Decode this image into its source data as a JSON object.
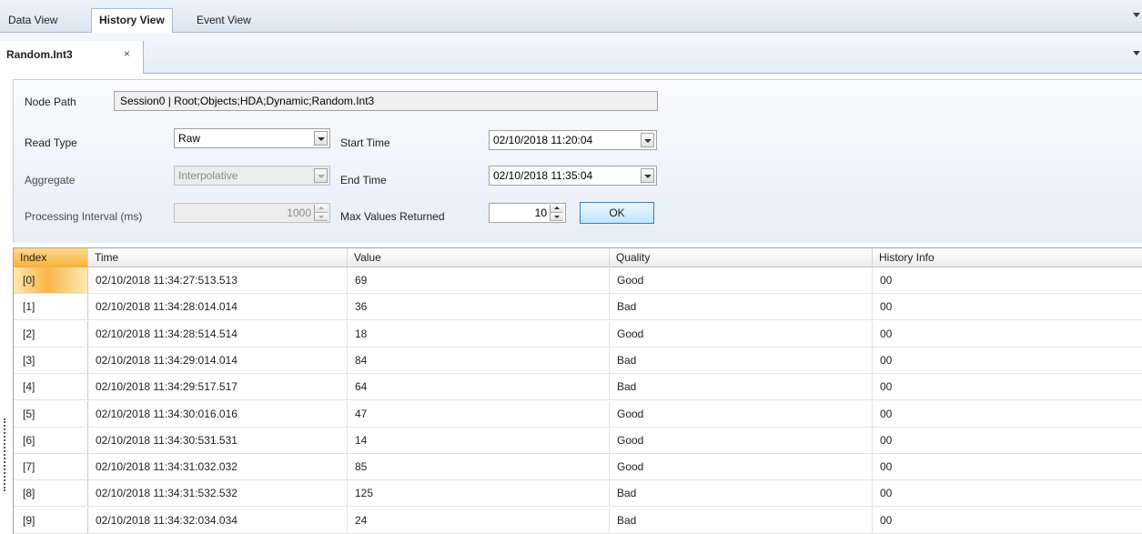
{
  "view_tabs": [
    {
      "label": "Data View",
      "active": false
    },
    {
      "label": "History View",
      "active": true
    },
    {
      "label": "Event View",
      "active": false
    }
  ],
  "document_tab": {
    "label": "Random.Int3",
    "close_glyph": "×"
  },
  "form": {
    "node_path_label": "Node Path",
    "node_path_value": "Session0 | Root;Objects;HDA;Dynamic;Random.Int3",
    "read_type_label": "Read Type",
    "read_type_value": "Raw",
    "aggregate_label": "Aggregate",
    "aggregate_value": "Interpolative",
    "processing_interval_label": "Processing Interval (ms)",
    "processing_interval_value": "1000",
    "start_time_label": "Start Time",
    "start_time_value": "02/10/2018 11:20:04",
    "end_time_label": "End Time",
    "end_time_value": "02/10/2018 11:35:04",
    "max_values_label": "Max Values Returned",
    "max_values_value": "10",
    "ok_label": "OK"
  },
  "grid": {
    "columns": [
      "Index",
      "Time",
      "Value",
      "Quality",
      "History Info"
    ],
    "rows": [
      [
        "[0]",
        "02/10/2018 11:34:27:513.513",
        "69",
        "Good",
        "00"
      ],
      [
        "[1]",
        "02/10/2018 11:34:28:014.014",
        "36",
        "Bad",
        "00"
      ],
      [
        "[2]",
        "02/10/2018 11:34:28:514.514",
        "18",
        "Good",
        "00"
      ],
      [
        "[3]",
        "02/10/2018 11:34:29:014.014",
        "84",
        "Bad",
        "00"
      ],
      [
        "[4]",
        "02/10/2018 11:34:29:517.517",
        "64",
        "Bad",
        "00"
      ],
      [
        "[5]",
        "02/10/2018 11:34:30:016.016",
        "47",
        "Good",
        "00"
      ],
      [
        "[6]",
        "02/10/2018 11:34:30:531.531",
        "14",
        "Good",
        "00"
      ],
      [
        "[7]",
        "02/10/2018 11:34:31:032.032",
        "85",
        "Good",
        "00"
      ],
      [
        "[8]",
        "02/10/2018 11:34:31:532.532",
        "125",
        "Bad",
        "00"
      ],
      [
        "[9]",
        "02/10/2018 11:34:32:034.034",
        "24",
        "Bad",
        "00"
      ]
    ]
  },
  "colors": {
    "selection_accent": "#f6b13d",
    "ok_button_border": "#3c7fb1",
    "tab_border": "#a9b9cf"
  },
  "icons": [
    "tab-menu-arrow-icon",
    "close-icon",
    "dropdown-arrow-icon",
    "spin-up-icon",
    "spin-down-icon"
  ]
}
